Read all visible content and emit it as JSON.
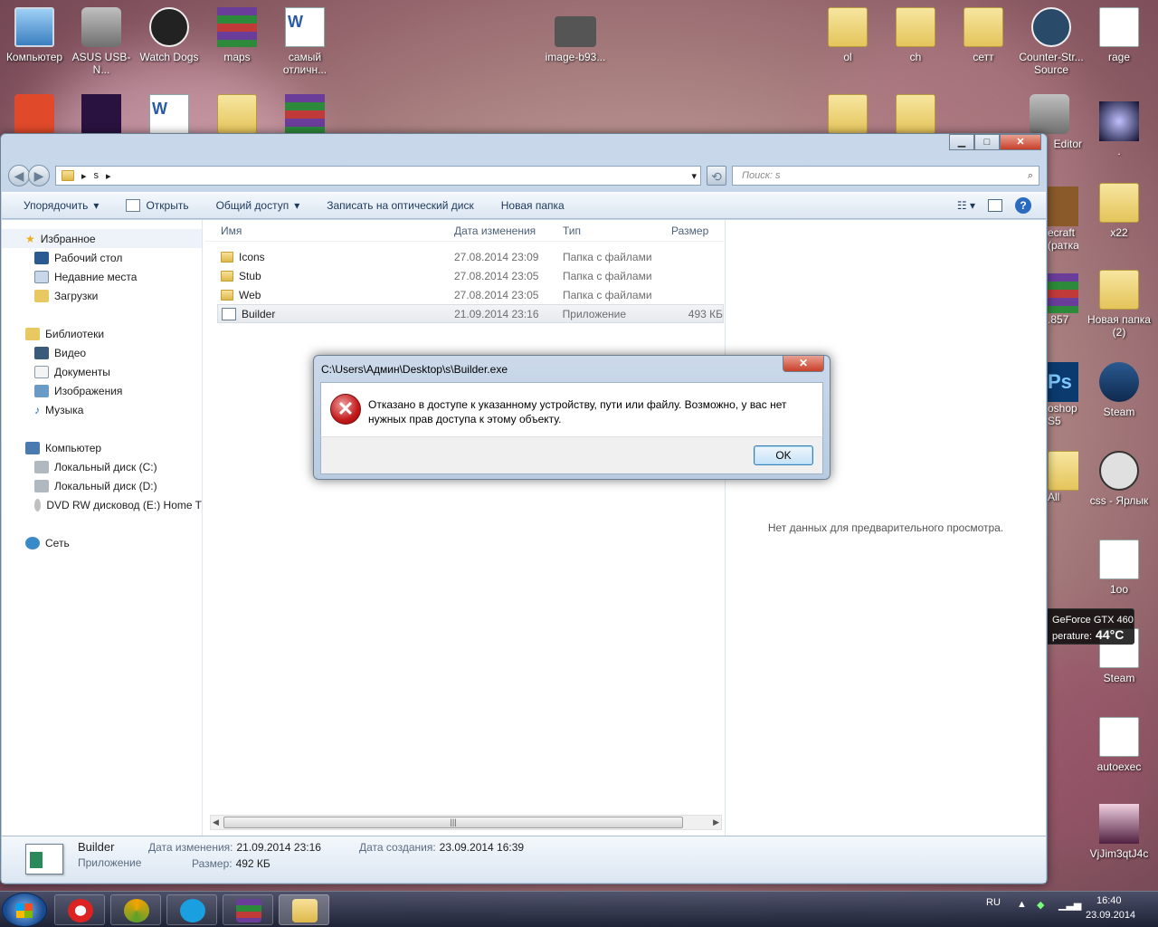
{
  "desktop": {
    "icons_left": [
      {
        "label": "Компьютер",
        "icon": "computer-icon"
      },
      {
        "label": "ASUS USB-N...",
        "icon": "wifi-tool-icon"
      },
      {
        "label": "Watch Dogs",
        "icon": "watch-dogs-icon"
      },
      {
        "label": "maps",
        "icon": "winrar-archive-icon"
      },
      {
        "label": "самый отличн...",
        "icon": "word-document-icon"
      },
      {
        "label": "image-b93...",
        "icon": "image-file-icon"
      }
    ],
    "icons_right": [
      {
        "label": "ol",
        "icon": "folder-icon"
      },
      {
        "label": "ch",
        "icon": "folder-icon"
      },
      {
        "label": "сетт",
        "icon": "folder-icon"
      },
      {
        "label": "Counter-Str... Source",
        "icon": "counter-strike-icon"
      },
      {
        "label": "rage",
        "icon": "text-file-icon"
      },
      {
        "label": "Editor",
        "icon": "editor-tool-icon"
      },
      {
        "label": ".",
        "icon": "space-image-icon"
      },
      {
        "label": "x22",
        "icon": "folder-icon"
      },
      {
        "label": "ecraft (ратка)",
        "icon": "minecraft-icon"
      },
      {
        "label": ".857",
        "icon": "winrar-archive-icon"
      },
      {
        "label": "Новая папка (2)",
        "icon": "folder-icon"
      },
      {
        "label": "oshop S5",
        "icon": "photoshop-icon"
      },
      {
        "label": "Steam",
        "icon": "steam-icon"
      },
      {
        "label": "All",
        "icon": "folder-icon"
      },
      {
        "label": "css - Ярлык",
        "icon": "css-shortcut-icon"
      },
      {
        "label": "1oo",
        "icon": "text-file-icon"
      },
      {
        "label": "Steam",
        "icon": "text-file-icon"
      },
      {
        "label": "autoexec",
        "icon": "text-file-icon"
      },
      {
        "label": "VjJim3qtJ4c",
        "icon": "photo-icon"
      }
    ]
  },
  "explorer": {
    "breadcrumb": [
      "s"
    ],
    "search_placeholder": "Поиск: s",
    "toolbar": {
      "organize": "Упорядочить",
      "open": "Открыть",
      "share": "Общий доступ",
      "burn": "Записать на оптический диск",
      "new_folder": "Новая папка"
    },
    "nav": {
      "favorites": "Избранное",
      "desktop": "Рабочий стол",
      "recent": "Недавние места",
      "downloads": "Загрузки",
      "libraries": "Библиотеки",
      "video": "Видео",
      "documents": "Документы",
      "images": "Изображения",
      "music": "Музыка",
      "computer": "Компьютер",
      "disk_c": "Локальный диск (C:)",
      "disk_d": "Локальный диск (D:)",
      "dvd": "DVD RW дисковод (E:) Home T",
      "network": "Сеть"
    },
    "columns": {
      "name": "Имя",
      "date": "Дата изменения",
      "type": "Тип",
      "size": "Размер"
    },
    "files": [
      {
        "name": "Icons",
        "date": "27.08.2014 23:09",
        "type": "Папка с файлами",
        "size": ""
      },
      {
        "name": "Stub",
        "date": "27.08.2014 23:05",
        "type": "Папка с файлами",
        "size": ""
      },
      {
        "name": "Web",
        "date": "27.08.2014 23:05",
        "type": "Папка с файлами",
        "size": ""
      },
      {
        "name": "Builder",
        "date": "21.09.2014 23:16",
        "type": "Приложение",
        "size": "493 КБ"
      }
    ],
    "preview_text": "Нет данных для предварительного просмотра.",
    "details": {
      "name": "Builder",
      "kind": "Приложение",
      "modified_label": "Дата изменения:",
      "modified_value": "21.09.2014 23:16",
      "size_label": "Размер:",
      "size_value": "492 КБ",
      "created_label": "Дата создания:",
      "created_value": "23.09.2014 16:39"
    }
  },
  "dialog": {
    "title": "C:\\Users\\Админ\\Desktop\\s\\Builder.exe",
    "message": "Отказано в доступе к указанному устройству, пути или файлу. Возможно,  у вас нет нужных прав доступа к этому объекту.",
    "ok": "OK"
  },
  "gpu_widget": {
    "name": "GeForce GTX 460",
    "label": "perature:",
    "value": "44°C"
  },
  "taskbar": {
    "lang": "RU",
    "time": "16:40",
    "date": "23.09.2014",
    "apps": [
      "yandex-browser-icon",
      "game-icon",
      "skype-icon",
      "winrar-icon",
      "explorer-icon"
    ]
  }
}
